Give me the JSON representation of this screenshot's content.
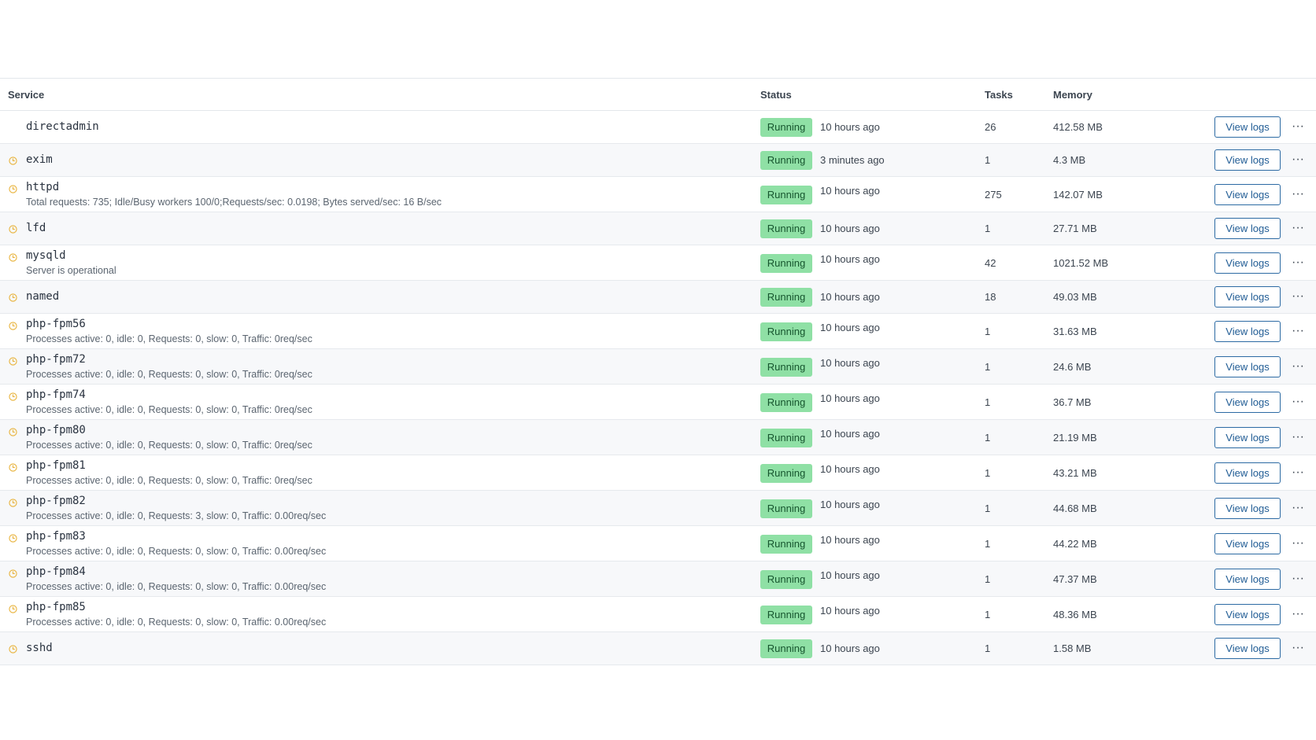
{
  "table": {
    "headers": {
      "service": "Service",
      "status": "Status",
      "tasks": "Tasks",
      "memory": "Memory"
    },
    "colors": {
      "running_badge_bg": "#8fe0a5",
      "running_badge_text": "#16552e",
      "clock_icon": "#e8b23a",
      "button_border": "#2c6aa3"
    },
    "rows": [
      {
        "name": "directadmin",
        "desc": "",
        "icon": "",
        "status": "Running",
        "since": "10 hours ago",
        "tasks": "26",
        "memory": "412.58 MB",
        "logs": "View logs",
        "more": "···"
      },
      {
        "name": "exim",
        "desc": "",
        "icon": "clock-icon",
        "status": "Running",
        "since": "3 minutes ago",
        "tasks": "1",
        "memory": "4.3 MB",
        "logs": "View logs",
        "more": "···"
      },
      {
        "name": "httpd",
        "desc": "Total requests: 735; Idle/Busy workers 100/0;Requests/sec: 0.0198; Bytes served/sec: 16 B/sec",
        "icon": "clock-icon",
        "status": "Running",
        "since": "10 hours ago",
        "tasks": "275",
        "memory": "142.07 MB",
        "logs": "View logs",
        "more": "···"
      },
      {
        "name": "lfd",
        "desc": "",
        "icon": "clock-icon",
        "status": "Running",
        "since": "10 hours ago",
        "tasks": "1",
        "memory": "27.71 MB",
        "logs": "View logs",
        "more": "···"
      },
      {
        "name": "mysqld",
        "desc": "Server is operational",
        "icon": "clock-icon",
        "status": "Running",
        "since": "10 hours ago",
        "tasks": "42",
        "memory": "1021.52 MB",
        "logs": "View logs",
        "more": "···"
      },
      {
        "name": "named",
        "desc": "",
        "icon": "clock-icon",
        "status": "Running",
        "since": "10 hours ago",
        "tasks": "18",
        "memory": "49.03 MB",
        "logs": "View logs",
        "more": "···"
      },
      {
        "name": "php-fpm56",
        "desc": "Processes active: 0, idle: 0, Requests: 0, slow: 0, Traffic: 0req/sec",
        "icon": "clock-icon",
        "status": "Running",
        "since": "10 hours ago",
        "tasks": "1",
        "memory": "31.63 MB",
        "logs": "View logs",
        "more": "···"
      },
      {
        "name": "php-fpm72",
        "desc": "Processes active: 0, idle: 0, Requests: 0, slow: 0, Traffic: 0req/sec",
        "icon": "clock-icon",
        "status": "Running",
        "since": "10 hours ago",
        "tasks": "1",
        "memory": "24.6 MB",
        "logs": "View logs",
        "more": "···"
      },
      {
        "name": "php-fpm74",
        "desc": "Processes active: 0, idle: 0, Requests: 0, slow: 0, Traffic: 0req/sec",
        "icon": "clock-icon",
        "status": "Running",
        "since": "10 hours ago",
        "tasks": "1",
        "memory": "36.7 MB",
        "logs": "View logs",
        "more": "···"
      },
      {
        "name": "php-fpm80",
        "desc": "Processes active: 0, idle: 0, Requests: 0, slow: 0, Traffic: 0req/sec",
        "icon": "clock-icon",
        "status": "Running",
        "since": "10 hours ago",
        "tasks": "1",
        "memory": "21.19 MB",
        "logs": "View logs",
        "more": "···"
      },
      {
        "name": "php-fpm81",
        "desc": "Processes active: 0, idle: 0, Requests: 0, slow: 0, Traffic: 0req/sec",
        "icon": "clock-icon",
        "status": "Running",
        "since": "10 hours ago",
        "tasks": "1",
        "memory": "43.21 MB",
        "logs": "View logs",
        "more": "···"
      },
      {
        "name": "php-fpm82",
        "desc": "Processes active: 0, idle: 0, Requests: 3, slow: 0, Traffic: 0.00req/sec",
        "icon": "clock-icon",
        "status": "Running",
        "since": "10 hours ago",
        "tasks": "1",
        "memory": "44.68 MB",
        "logs": "View logs",
        "more": "···"
      },
      {
        "name": "php-fpm83",
        "desc": "Processes active: 0, idle: 0, Requests: 0, slow: 0, Traffic: 0.00req/sec",
        "icon": "clock-icon",
        "status": "Running",
        "since": "10 hours ago",
        "tasks": "1",
        "memory": "44.22 MB",
        "logs": "View logs",
        "more": "···"
      },
      {
        "name": "php-fpm84",
        "desc": "Processes active: 0, idle: 0, Requests: 0, slow: 0, Traffic: 0.00req/sec",
        "icon": "clock-icon",
        "status": "Running",
        "since": "10 hours ago",
        "tasks": "1",
        "memory": "47.37 MB",
        "logs": "View logs",
        "more": "···"
      },
      {
        "name": "php-fpm85",
        "desc": "Processes active: 0, idle: 0, Requests: 0, slow: 0, Traffic: 0.00req/sec",
        "icon": "clock-icon",
        "status": "Running",
        "since": "10 hours ago",
        "tasks": "1",
        "memory": "48.36 MB",
        "logs": "View logs",
        "more": "···"
      },
      {
        "name": "sshd",
        "desc": "",
        "icon": "clock-icon",
        "status": "Running",
        "since": "10 hours ago",
        "tasks": "1",
        "memory": "1.58 MB",
        "logs": "View logs",
        "more": "···"
      }
    ]
  }
}
